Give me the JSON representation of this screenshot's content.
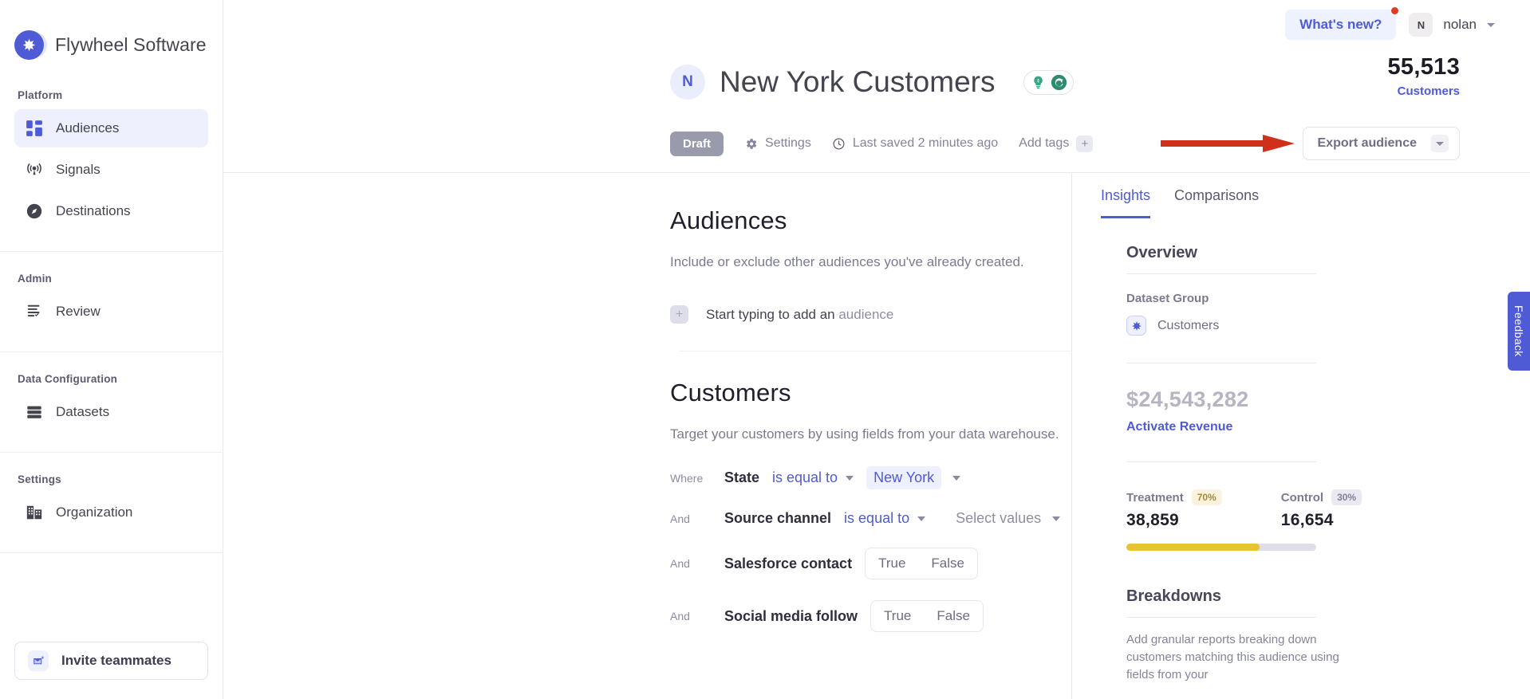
{
  "brand": {
    "name": "Flywheel Software",
    "logo_icon": "flywheel-star-icon"
  },
  "sidebar": {
    "groups": [
      {
        "label": "Platform",
        "items": [
          {
            "label": "Audiences",
            "icon": "grid-icon",
            "active": true
          },
          {
            "label": "Signals",
            "icon": "broadcast-icon",
            "active": false
          },
          {
            "label": "Destinations",
            "icon": "compass-icon",
            "active": false
          }
        ]
      },
      {
        "label": "Admin",
        "items": [
          {
            "label": "Review",
            "icon": "checklist-icon",
            "active": false
          }
        ]
      },
      {
        "label": "Data Configuration",
        "items": [
          {
            "label": "Datasets",
            "icon": "database-icon",
            "active": false
          }
        ]
      },
      {
        "label": "Settings",
        "items": [
          {
            "label": "Organization",
            "icon": "building-icon",
            "active": false
          }
        ]
      }
    ],
    "invite": {
      "label": "Invite teammates",
      "icon": "envelope-plus-icon"
    }
  },
  "topbar": {
    "whats_new": "What's new?",
    "user_initial": "N",
    "user_name": "nolan",
    "notification_dot_color": "#e03c20"
  },
  "header": {
    "avatar_initial": "N",
    "title": "New York Customers",
    "badge_icons": [
      "lightbulb-icon",
      "refresh-icon"
    ],
    "count_value": "55,513",
    "count_label": "Customers",
    "status_chip": "Draft",
    "settings_label": "Settings",
    "last_saved": "Last saved 2 minutes ago",
    "add_tags_label": "Add tags",
    "export_label": "Export audience",
    "arrow_color": "#d0301a"
  },
  "canvas": {
    "audiences": {
      "title": "Audiences",
      "description": "Include or exclude other audiences you've already created.",
      "add_prefix": "Start typing to add an ",
      "add_suffix": "audience"
    },
    "customers": {
      "title": "Customers",
      "description": "Target your customers by using fields from your data warehouse.",
      "rules": [
        {
          "conj": "Where",
          "field": "State",
          "operator": "is equal to",
          "value": "New York",
          "kind": "pill"
        },
        {
          "conj": "And",
          "field": "Source channel",
          "operator": "is equal to",
          "value": "Select values",
          "kind": "placeholder"
        },
        {
          "conj": "And",
          "field": "Salesforce contact",
          "kind": "bool",
          "true_label": "True",
          "false_label": "False"
        },
        {
          "conj": "And",
          "field": "Social media follow",
          "kind": "bool",
          "true_label": "True",
          "false_label": "False"
        }
      ]
    }
  },
  "insights": {
    "tabs": [
      {
        "label": "Insights",
        "active": true
      },
      {
        "label": "Comparisons",
        "active": false
      }
    ],
    "overview_title": "Overview",
    "dataset_group_label": "Dataset Group",
    "dataset_group_name": "Customers",
    "revenue_value": "$24,543,282",
    "revenue_link": "Activate Revenue",
    "treatment_label": "Treatment",
    "treatment_pct": "70%",
    "treatment_value": "38,859",
    "control_label": "Control",
    "control_pct": "30%",
    "control_value": "16,654",
    "bar_fill_percent": 70,
    "bar_color": "#e8c32e",
    "breakdowns_title": "Breakdowns",
    "breakdowns_desc": "Add granular reports breaking down customers matching this audience using fields from your"
  },
  "feedback": {
    "label": "Feedback"
  }
}
